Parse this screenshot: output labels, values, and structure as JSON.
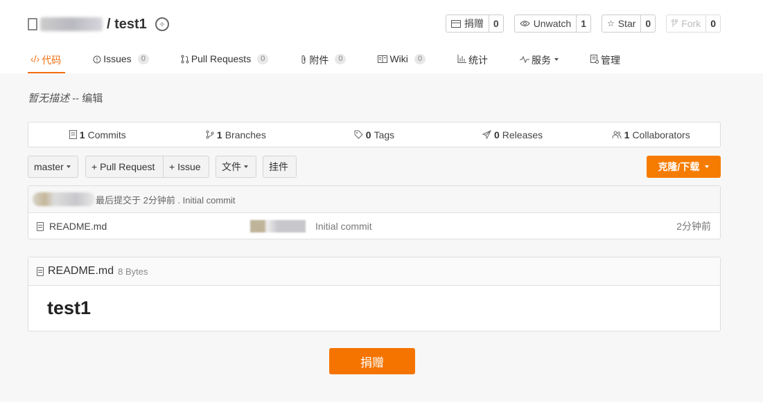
{
  "repo": {
    "name": "/ test1"
  },
  "actions": [
    {
      "label": "捐赠",
      "count": "0"
    },
    {
      "label": "Unwatch",
      "count": "1"
    },
    {
      "label": "Star",
      "count": "0"
    },
    {
      "label": "Fork",
      "count": "0"
    }
  ],
  "tabs": [
    {
      "label": "代码",
      "count": ""
    },
    {
      "label": "Issues",
      "count": "0"
    },
    {
      "label": "Pull Requests",
      "count": "0"
    },
    {
      "label": "附件",
      "count": "0"
    },
    {
      "label": "Wiki",
      "count": "0"
    },
    {
      "label": "统计",
      "count": ""
    },
    {
      "label": "服务",
      "count": ""
    },
    {
      "label": "管理",
      "count": ""
    }
  ],
  "description": {
    "text": "暂无描述",
    "separator": " -- ",
    "edit_label": "编辑"
  },
  "stats": [
    {
      "count": "1",
      "label": "Commits"
    },
    {
      "count": "1",
      "label": "Branches"
    },
    {
      "count": "0",
      "label": "Tags"
    },
    {
      "count": "0",
      "label": "Releases"
    },
    {
      "count": "1",
      "label": "Collaborators"
    }
  ],
  "toolbar": {
    "branch": "master",
    "pull_request": "+ Pull Request",
    "issue": "+ Issue",
    "files": "文件",
    "plugins": "挂件",
    "clone": "克隆/下载"
  },
  "last_commit": {
    "text": "最后提交于 2分钟前 . Initial commit"
  },
  "files": [
    {
      "name": "README.md",
      "message": "Initial commit",
      "time": "2分钟前"
    }
  ],
  "readme": {
    "filename": "README.md",
    "size": "8 Bytes",
    "heading": "test1"
  },
  "donate_button": "捐赠",
  "colors": {
    "accent": "#f36e10",
    "button_orange": "#f57c00"
  }
}
